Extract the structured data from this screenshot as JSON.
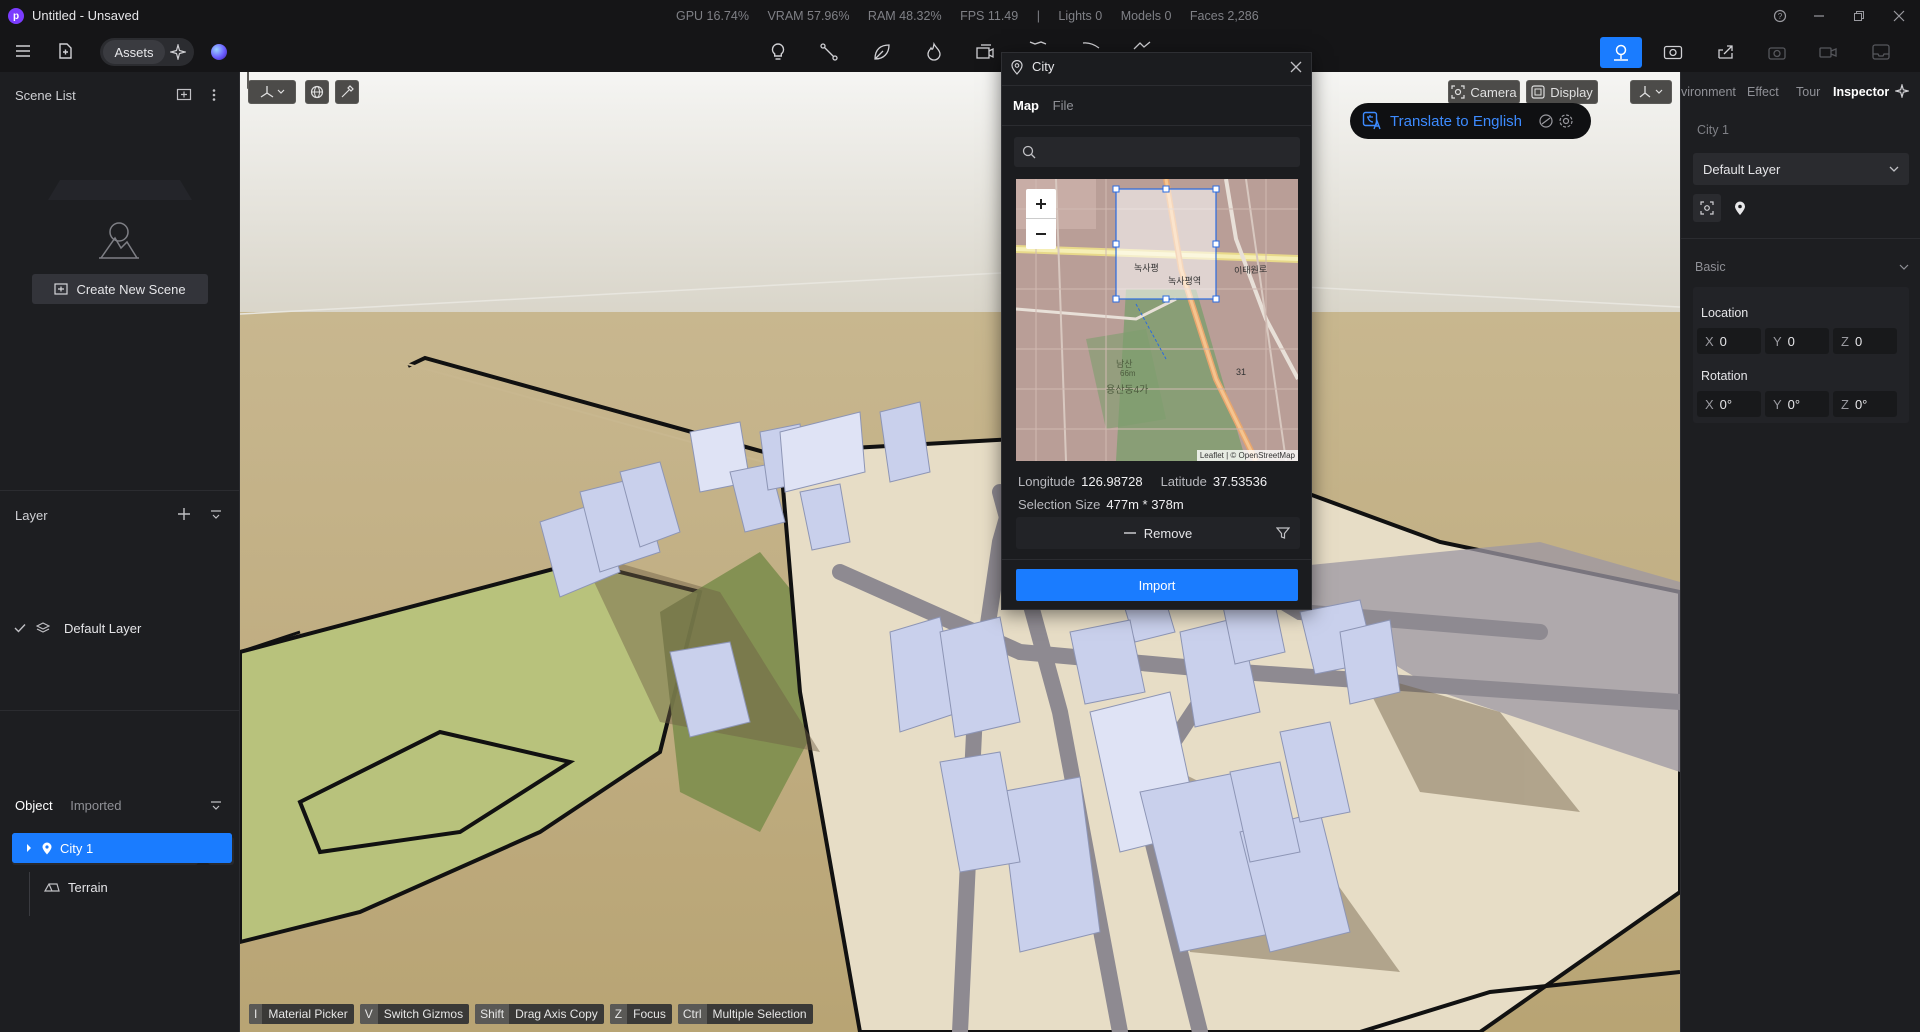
{
  "app": {
    "logo_letter": "p",
    "title": "Untitled - Unsaved",
    "stats": [
      "GPU 16.74%",
      "VRAM 57.96%",
      "RAM 48.32%",
      "FPS 11.49",
      "|",
      "Lights 0",
      "Models 0",
      "Faces 2,286"
    ]
  },
  "toolbar": {
    "assets_label": "Assets",
    "center_tools": [
      "light-icon",
      "path-icon",
      "leaf-icon",
      "fire-icon",
      "animation-icon",
      "map-icon",
      "draw-icon",
      "terrain-icon"
    ],
    "right_tools": [
      "map-import-icon",
      "render-icon",
      "share-icon",
      "camera-icon",
      "video-icon",
      "export-icon"
    ]
  },
  "left_panel": {
    "scene_list_title": "Scene List",
    "create_scene_label": "Create New Scene",
    "layer_title": "Layer",
    "layers": [
      {
        "name": "Default Layer",
        "checked": true
      }
    ],
    "object_tab": "Object",
    "imported_tab": "Imported",
    "tree": [
      {
        "name": "Terrain",
        "icon": "terrain-icon",
        "selected": false
      },
      {
        "name": "City 1",
        "icon": "location-pin-icon",
        "selected": true
      }
    ]
  },
  "viewport": {
    "camera_label": "Camera",
    "display_label": "Display",
    "shortcuts": [
      {
        "key": "I",
        "label": "Material Picker"
      },
      {
        "key": "V",
        "label": "Switch Gizmos"
      },
      {
        "key": "Shift",
        "label": "Drag Axis Copy"
      },
      {
        "key": "Z",
        "label": "Focus"
      },
      {
        "key": "Ctrl",
        "label": "Multiple Selection"
      }
    ],
    "translate_label": "Translate to English",
    "colors": {
      "ground": "#c5b389",
      "sky": "#e8e8e6",
      "park": "#b8c27c",
      "buildings": "#c9d0ec"
    }
  },
  "city_dialog": {
    "title": "City",
    "tabs": [
      "Map",
      "File"
    ],
    "active_tab": "Map",
    "search_placeholder": "",
    "map_labels": {
      "station": "녹사평",
      "station2": "녹사평역",
      "road": "이태원로",
      "mountain": "남산",
      "mountain_height": "66m",
      "district": "용산동4가",
      "route": "31",
      "attribution": "Leaflet | © OpenStreetMap"
    },
    "longitude_label": "Longitude",
    "longitude_value": "126.98728",
    "latitude_label": "Latitude",
    "latitude_value": "37.53536",
    "selection_label": "Selection Size",
    "selection_value": "477m * 378m",
    "remove_label": "Remove",
    "import_label": "Import"
  },
  "right_panel": {
    "tabs": [
      "vironment",
      "Effect",
      "Tour",
      "Inspector"
    ],
    "active_tab": "Inspector",
    "object_name": "City 1",
    "layer_select": "Default Layer",
    "basic_title": "Basic",
    "location_label": "Location",
    "location": {
      "x": "0",
      "y": "0",
      "z": "0"
    },
    "rotation_label": "Rotation",
    "rotation": {
      "x": "0°",
      "y": "0°",
      "z": "0°"
    }
  }
}
